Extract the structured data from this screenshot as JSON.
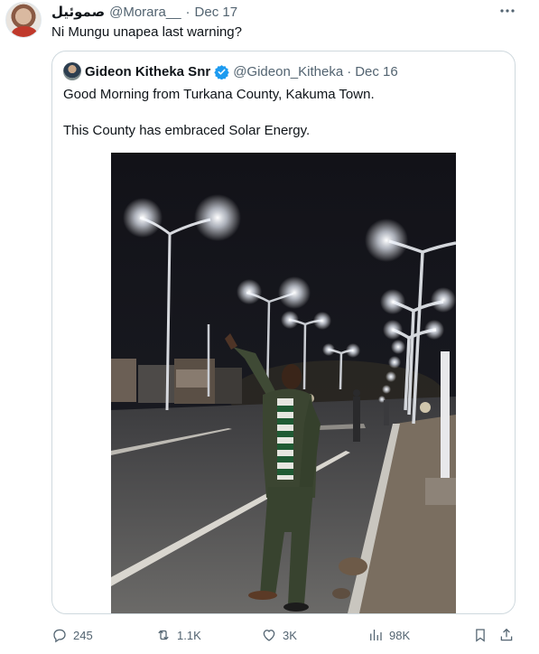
{
  "tweet": {
    "author_name": "صموئيل",
    "handle": "@Morara__",
    "separator": "·",
    "date": "Dec 17",
    "text": "Ni Mungu unapea last warning?",
    "more_icon": "more-icon"
  },
  "quoted": {
    "author_name": "Gideon Kitheka Snr",
    "handle": "@Gideon_Kitheka",
    "separator": "·",
    "date": "Dec 16",
    "verified_color": "#1d9bf0",
    "paragraphs": [
      "Good Morning from Turkana County, Kakuma Town.",
      "This County has embraced Solar Energy."
    ]
  },
  "actions": {
    "replies": "245",
    "reposts": "1.1K",
    "likes": "3K",
    "views": "98K"
  },
  "colors": {
    "text": "#0f1419",
    "muted": "#536471",
    "border": "#cfd9de",
    "accent": "#1d9bf0"
  }
}
